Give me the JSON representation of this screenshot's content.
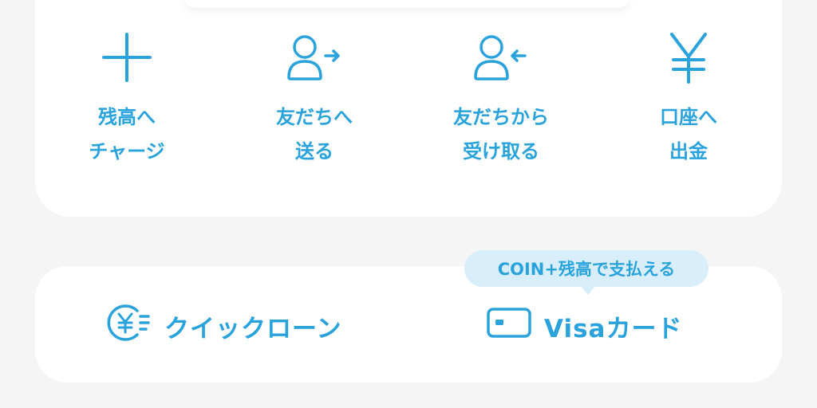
{
  "actions": [
    {
      "icon": "plus-icon",
      "line1": "残高へ",
      "line2": "チャージ"
    },
    {
      "icon": "person-send-icon",
      "line1": "友だちへ",
      "line2": "送る"
    },
    {
      "icon": "person-receive-icon",
      "line1": "友だちから",
      "line2": "受け取る"
    },
    {
      "icon": "yen-icon",
      "line1": "口座へ",
      "line2": "出金"
    }
  ],
  "quick_loan": {
    "icon": "yen-coin-icon",
    "label": "クイックローン"
  },
  "visa": {
    "icon": "card-icon",
    "label": "Visaカード"
  },
  "tooltip": {
    "text": "COIN+残高で支払える"
  },
  "colors": {
    "accent": "#2aa3dc",
    "tooltip_bg": "#d8eefa",
    "card_bg": "#ffffff",
    "page_bg": "#f5f5f5"
  }
}
